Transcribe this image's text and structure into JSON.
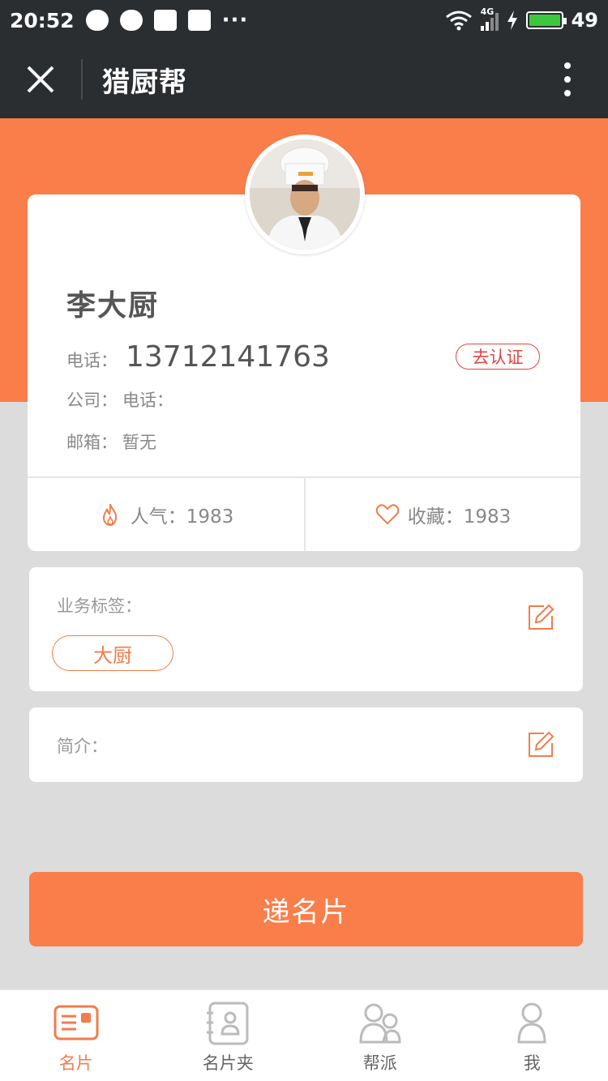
{
  "status_bar": {
    "time": "20:52",
    "network": "4G",
    "battery": "49",
    "more": "···"
  },
  "nav": {
    "title": "猎厨帮",
    "close_icon": "close-icon",
    "menu_icon": "more-vertical-icon"
  },
  "colors": {
    "accent": "#fa7e4a",
    "verify": "#e34545",
    "nav_bg": "#2b2e31"
  },
  "profile": {
    "name": "李大厨",
    "phone_label": "电话：",
    "phone_value": "13712141763",
    "verify_label": "去认证",
    "company_label": "公司：",
    "company_value": "电话：",
    "email_label": "邮箱：",
    "email_value": "暂无",
    "popularity_label": "人气：1983",
    "favorites_label": "收藏：1983"
  },
  "business_tags": {
    "label": "业务标签：",
    "tags": [
      "大厨"
    ]
  },
  "intro": {
    "label": "简介："
  },
  "cta": {
    "label": "递名片"
  },
  "tab_bar": {
    "items": [
      {
        "label": "名片",
        "icon": "card-icon",
        "active": true
      },
      {
        "label": "名片夹",
        "icon": "contacts-book-icon",
        "active": false
      },
      {
        "label": "帮派",
        "icon": "group-icon",
        "active": false
      },
      {
        "label": "我",
        "icon": "person-icon",
        "active": false
      }
    ]
  }
}
